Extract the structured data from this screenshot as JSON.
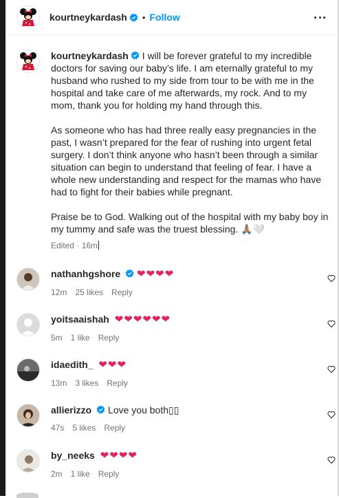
{
  "header": {
    "username": "kourtneykardash",
    "separator": "•",
    "follow_label": "Follow"
  },
  "caption": {
    "username": "kourtneykardash",
    "paragraphs": [
      "I will be forever grateful to my incredible doctors for saving our baby’s life. I am eternally grateful to my husband who rushed to my side from tour to be with me in the hospital and take care of me afterwards, my rock. And to my mom, thank you for holding my hand through this.",
      "As someone who has had three really easy pregnancies in the past, I wasn’t prepared for the fear of rushing into urgent fetal surgery. I don’t think anyone who hasn’t been through a similar situation can begin to understand that feeling of fear. I have a whole new understanding and respect for the mamas who have had to fight for their babies while pregnant.",
      "Praise be to God. Walking out of the hospital with my baby boy in my tummy and safe was the truest blessing. 🙏🏽🤍"
    ],
    "meta": "Edited · 16m"
  },
  "comments": [
    {
      "username": "nathanhgshore",
      "verified": true,
      "text": "❤❤❤❤",
      "time": "12m",
      "likes": "25 likes",
      "reply": "Reply"
    },
    {
      "username": "yoitsaaishah",
      "verified": false,
      "text": "❤❤❤❤❤❤",
      "time": "5m",
      "likes": "1 like",
      "reply": "Reply"
    },
    {
      "username": "idaedith_",
      "verified": false,
      "text": "❤❤❤",
      "time": "13m",
      "likes": "3 likes",
      "reply": "Reply"
    },
    {
      "username": "allierizzo",
      "verified": true,
      "text": "Love you both▯▯",
      "time": "47s",
      "likes": "5 likes",
      "reply": "Reply"
    },
    {
      "username": "by_neeks",
      "verified": false,
      "text": "❤❤❤❤",
      "time": "2m",
      "likes": "1 like",
      "reply": "Reply"
    }
  ],
  "colors": {
    "accent": "#0095f6",
    "verified": "#0095f6",
    "heart": "#e0245e",
    "muted": "#737373"
  }
}
